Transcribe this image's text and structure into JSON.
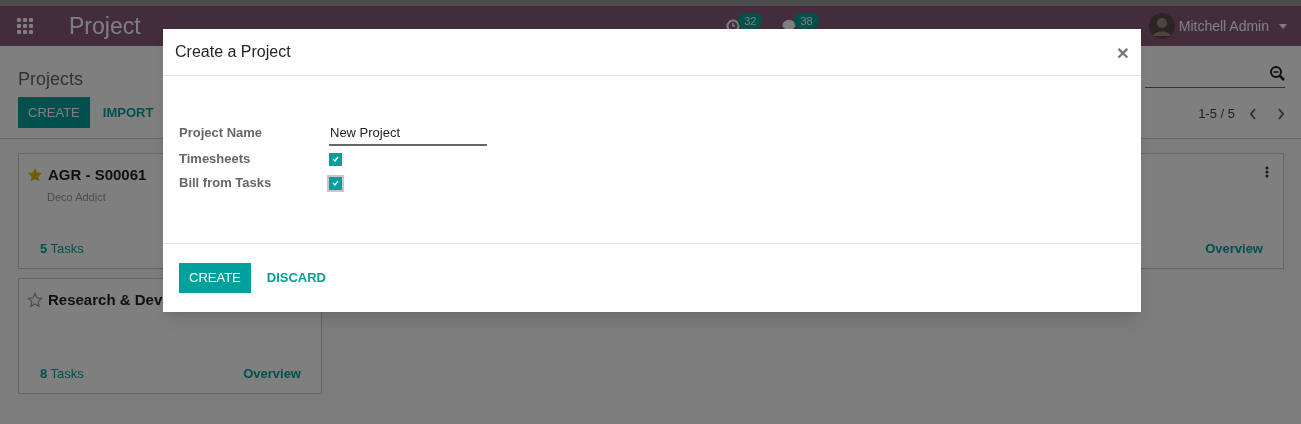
{
  "navbar": {
    "app_name": "Project",
    "activity_count": "32",
    "message_count": "38",
    "user": "Mitchell Admin"
  },
  "control_panel": {
    "breadcrumb": "Projects",
    "buttons": [
      "CREATE",
      "IMPORT"
    ],
    "pager": "1-5 / 5"
  },
  "cards": [
    {
      "name": "AGR - S00061",
      "customer": "Deco Addict",
      "favorite": true,
      "tasks_count": "5",
      "tasks_label": "Tasks"
    },
    {
      "overview": "Overview",
      "menu": true
    },
    {
      "name": "Research & Dev",
      "favorite": false,
      "tasks_count": "8",
      "tasks_label": "Tasks",
      "overview": "Overview"
    }
  ],
  "dialog": {
    "title": "Create a Project",
    "close": "×",
    "fields": [
      {
        "kind": "text",
        "label": "Project Name",
        "value": "New Project"
      },
      {
        "kind": "checkbox",
        "label": "Timesheets",
        "checked": true,
        "focused": false
      },
      {
        "kind": "checkbox",
        "label": "Bill from Tasks",
        "checked": true,
        "focused": true
      }
    ],
    "buttons": [
      {
        "label": "CREATE",
        "kind": "primary"
      },
      {
        "label": "DISCARD",
        "kind": "link"
      }
    ]
  }
}
